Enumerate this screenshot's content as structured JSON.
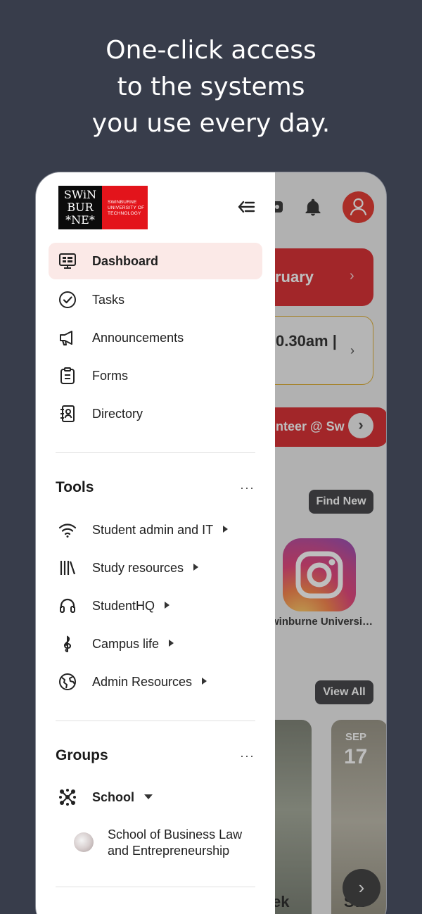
{
  "headline": {
    "line1": "One-click access",
    "line2": "to the systems",
    "line3": "you use every day."
  },
  "background": {
    "month_card": "ruary",
    "time_card": "0.30am |",
    "volunteer_card": "unteer @ Sw",
    "find_new_label": "Find New",
    "instagram_label": "winburne Universi…",
    "view_all_label": "View All",
    "event_month": "SEP",
    "event_day": "17",
    "photo_caption_1": "ek",
    "photo_caption_2": "Sw",
    "colors": {
      "brand_red": "#d4161b",
      "accent_orange": "#d9a520"
    }
  },
  "drawer": {
    "logo": {
      "black_text": "SWiN BUR *NE*",
      "red_text": "SWINBURNE UNIVERSITY OF TECHNOLOGY"
    },
    "nav": [
      {
        "label": "Dashboard",
        "icon": "monitor-icon",
        "active": true
      },
      {
        "label": "Tasks",
        "icon": "check-circle-icon",
        "active": false
      },
      {
        "label": "Announcements",
        "icon": "megaphone-icon",
        "active": false
      },
      {
        "label": "Forms",
        "icon": "clipboard-icon",
        "active": false
      },
      {
        "label": "Directory",
        "icon": "contacts-book-icon",
        "active": false
      }
    ],
    "tools": {
      "title": "Tools",
      "more": "···",
      "items": [
        {
          "label": "Student admin and IT",
          "icon": "wifi-icon"
        },
        {
          "label": "Study resources",
          "icon": "books-icon"
        },
        {
          "label": "StudentHQ",
          "icon": "headset-icon"
        },
        {
          "label": "Campus life",
          "icon": "treble-clef-icon"
        },
        {
          "label": "Admin Resources",
          "icon": "globe-icon"
        }
      ]
    },
    "groups": {
      "title": "Groups",
      "more": "···",
      "school_label": "School",
      "sub_items": [
        {
          "label": "School of Business Law and Entrepreneurship"
        }
      ]
    }
  }
}
